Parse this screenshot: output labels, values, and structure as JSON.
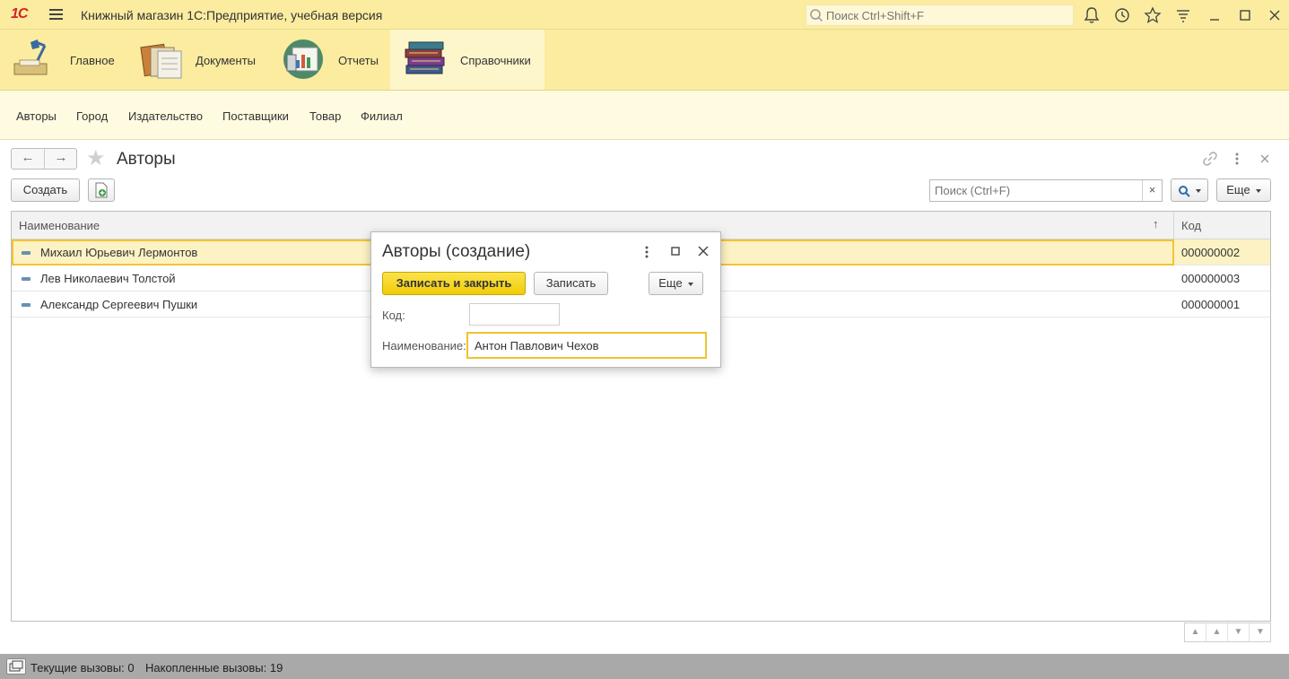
{
  "app": {
    "logo": "1С",
    "title": "Книжный магазин 1С:Предприятие, учебная версия",
    "search_placeholder": "Поиск Ctrl+Shift+F"
  },
  "sections": [
    {
      "label": "Главное",
      "icon": "desk-lamp-icon"
    },
    {
      "label": "Документы",
      "icon": "documents-folder-icon"
    },
    {
      "label": "Отчеты",
      "icon": "reports-chart-icon"
    },
    {
      "label": "Справочники",
      "icon": "books-stack-icon",
      "active": true
    }
  ],
  "nav_links": [
    "Авторы",
    "Город",
    "Издательство",
    "Поставщики",
    "Товар",
    "Филиал"
  ],
  "form": {
    "title": "Авторы",
    "create_label": "Создать",
    "search_placeholder": "Поиск (Ctrl+F)",
    "clear_label": "×",
    "more_label": "Еще",
    "columns": {
      "name": "Наименование",
      "code": "Код"
    },
    "rows": [
      {
        "name": "Михаил Юрьевич Лермонтов",
        "code": "000000002",
        "selected": true
      },
      {
        "name": "Лев Николаевич Толстой",
        "code": "000000003"
      },
      {
        "name": "Александр Сергеевич Пушки",
        "code": "000000001"
      }
    ]
  },
  "modal": {
    "title": "Авторы (создание)",
    "save_close_label": "Записать и закрыть",
    "save_label": "Записать",
    "more_label": "Еще",
    "code_label": "Код:",
    "code_value": "",
    "name_label": "Наименование:",
    "name_value": "Антон Павлович Чехов"
  },
  "status": {
    "current_calls": "Текущие вызовы: 0",
    "accumulated_calls": "Накопленные вызовы: 19"
  },
  "colors": {
    "panel_yellow": "#fbeca0",
    "nav_yellow": "#fffbe0",
    "primary_button": "#f0cc08",
    "selection": "#fcf2c4"
  }
}
